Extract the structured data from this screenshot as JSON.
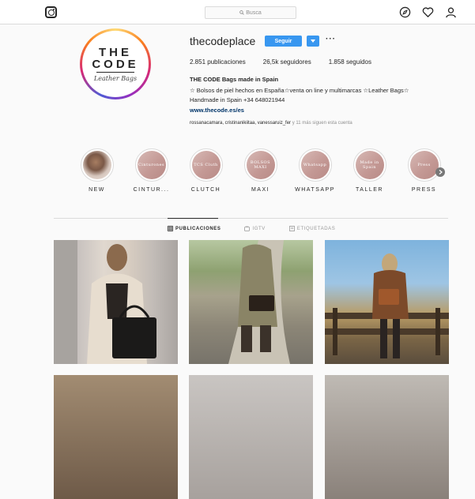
{
  "topbar": {
    "search_placeholder": "Busca",
    "icons": [
      "instagram-icon",
      "search-icon",
      "compass-icon",
      "heart-icon",
      "user-icon"
    ]
  },
  "profile": {
    "avatar": {
      "line1": "THE",
      "line2": "CODE",
      "line3": "Leather Bags"
    },
    "username": "thecodeplace",
    "follow_label": "Seguir",
    "more_label": "···",
    "stats": {
      "posts_value": "2.851",
      "posts_label": "publicaciones",
      "followers_value": "26,5k",
      "followers_label": "seguidores",
      "following_value": "1.858",
      "following_label": "seguidos"
    },
    "bio_name": "THE CODE Bags made in Spain",
    "bio_text": "☆ Bolsos de piel hechos en España☆venta on line y multimarcas ☆Leather Bags☆ Handmade in Spain +34 648021944",
    "link": "www.thecode.es/es",
    "followed_by_names": "rossanacamara, cristinanikiitaa, vanessaruiz_fer",
    "followed_by_rest": " y 11 más siguen esta cuenta"
  },
  "highlights": [
    {
      "label": "NEW",
      "cover": ""
    },
    {
      "label": "CINTUR...",
      "cover": "Cinturones"
    },
    {
      "label": "CLUTCH",
      "cover": "TCS Cluth"
    },
    {
      "label": "MAXI",
      "cover": "BOLSOS MAXI"
    },
    {
      "label": "WHATSAPP",
      "cover": "Whatsapp"
    },
    {
      "label": "TALLER",
      "cover": "Made in Spain"
    },
    {
      "label": "PRESS",
      "cover": "Press"
    }
  ],
  "tabs": [
    {
      "label": "PUBLICACIONES",
      "active": true
    },
    {
      "label": "IGTV",
      "active": false
    },
    {
      "label": "ETIQUETADAS",
      "active": false
    }
  ],
  "colors": {
    "accent": "#3897f0",
    "link": "#003569",
    "border": "#dbdbdb",
    "background": "#fafafa"
  }
}
